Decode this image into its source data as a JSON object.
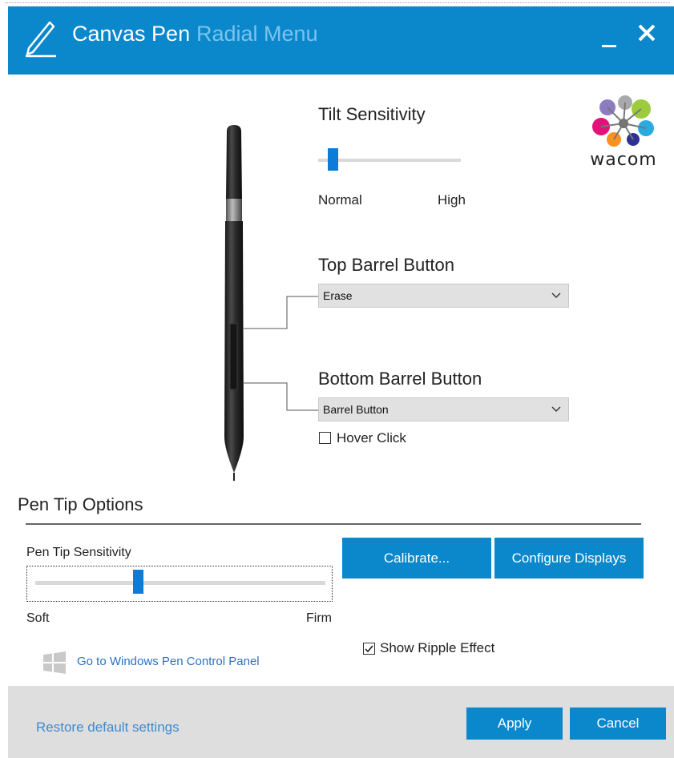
{
  "window": {
    "title": "Canvas Pen",
    "inactive_tab": "Radial Menu",
    "minimize_icon": "minimize-icon",
    "close_icon": "close-icon",
    "app_icon": "pen-icon",
    "accent_color": "#0b87cb"
  },
  "logo": {
    "text": "wacom",
    "icon": "wacom-logo"
  },
  "tilt": {
    "title": "Tilt Sensitivity",
    "min_label": "Normal",
    "max_label": "High",
    "value_fraction": 0.07
  },
  "top_barrel": {
    "title": "Top Barrel Button",
    "selected": "Erase",
    "chevron_icon": "chevron-down-icon"
  },
  "bottom_barrel": {
    "title": "Bottom Barrel Button",
    "selected": "Barrel Button",
    "chevron_icon": "chevron-down-icon"
  },
  "hover_click": {
    "label": "Hover Click",
    "checked": false
  },
  "pen_tip": {
    "section_title": "Pen Tip Options",
    "sensitivity_label": "Pen Tip Sensitivity",
    "min_label": "Soft",
    "max_label": "Firm",
    "value_fraction": 0.35
  },
  "buttons": {
    "calibrate": "Calibrate...",
    "configure": "Configure Displays",
    "apply": "Apply",
    "cancel": "Cancel"
  },
  "ripple": {
    "label": "Show Ripple Effect",
    "checked": true
  },
  "links": {
    "windows_pen": "Go to Windows Pen Control Panel",
    "windows_icon": "windows-logo-icon",
    "restore": "Restore default settings"
  }
}
